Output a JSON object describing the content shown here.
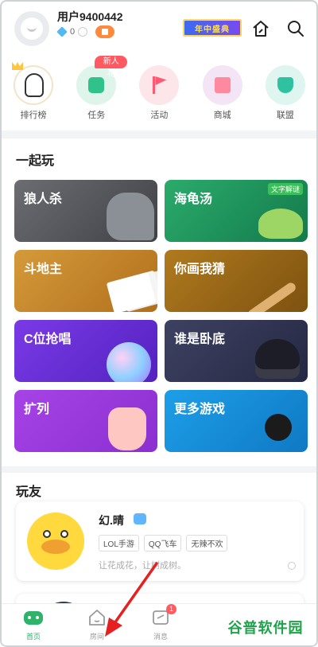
{
  "header": {
    "username": "用户9400442",
    "diamonds": "0",
    "banner": "年中盛典"
  },
  "shortcuts": [
    {
      "label": "排行榜",
      "icon": "ranking-icon"
    },
    {
      "label": "任务",
      "icon": "task-icon",
      "badge": "新人礼"
    },
    {
      "label": "活动",
      "icon": "flag-icon"
    },
    {
      "label": "商城",
      "icon": "shop-icon"
    },
    {
      "label": "联盟",
      "icon": "alliance-icon"
    }
  ],
  "together": {
    "title": "一起玩",
    "games": [
      {
        "label": "狼人杀"
      },
      {
        "label": "海龟汤",
        "tag": "文字解谜"
      },
      {
        "label": "斗地主"
      },
      {
        "label": "你画我猜"
      },
      {
        "label": "C位抢唱"
      },
      {
        "label": "谁是卧底"
      },
      {
        "label": "扩列"
      },
      {
        "label": "更多游戏"
      }
    ]
  },
  "friends": {
    "title": "玩友",
    "items": [
      {
        "name": "幻.晴",
        "tags": [
          "LOL手游",
          "QQ飞车",
          "无辣不欢"
        ],
        "desc": "让花成花，让树成树。"
      }
    ]
  },
  "bottom_nav": [
    {
      "label": "首页",
      "active": true
    },
    {
      "label": "房间"
    },
    {
      "label": "消息",
      "badge": "1"
    }
  ],
  "watermark": "谷普软件园",
  "colors": {
    "accent_green": "#2fb36b",
    "badge_red": "#ff5a62"
  }
}
